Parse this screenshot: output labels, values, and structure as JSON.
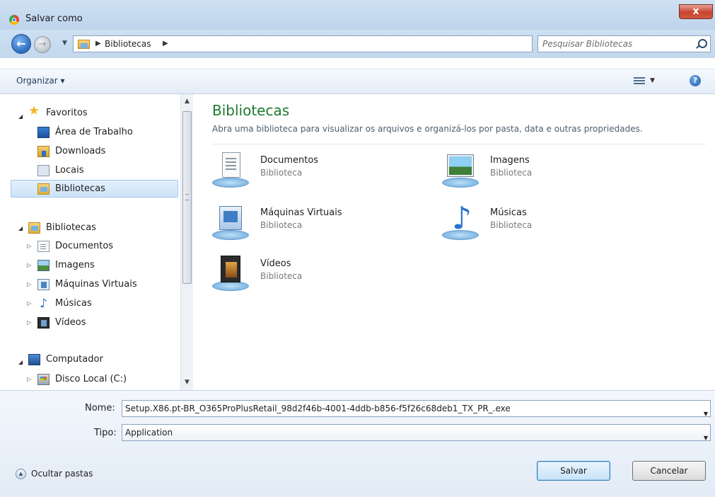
{
  "window": {
    "title": "Salvar como",
    "close_glyph": "x"
  },
  "address": {
    "crumb": "Bibliotecas",
    "search_placeholder": "Pesquisar Bibliotecas"
  },
  "toolbar": {
    "organize_label": "Organizar ▾"
  },
  "nav": {
    "favorites_header": "Favoritos",
    "favorites": [
      {
        "label": "Área de Trabalho",
        "icon": "desktop-icon"
      },
      {
        "label": "Downloads",
        "icon": "downloads-icon"
      },
      {
        "label": "Locais",
        "icon": "places-icon"
      },
      {
        "label": "Bibliotecas",
        "icon": "libraries-icon",
        "selected": true
      }
    ],
    "libraries_header": "Bibliotecas",
    "libraries": [
      {
        "label": "Documentos",
        "icon": "documents-icon"
      },
      {
        "label": "Imagens",
        "icon": "pictures-icon"
      },
      {
        "label": "Máquinas Virtuais",
        "icon": "virtual-machines-icon"
      },
      {
        "label": "Músicas",
        "icon": "music-icon"
      },
      {
        "label": "Vídeos",
        "icon": "videos-icon"
      }
    ],
    "computer_header": "Computador",
    "drives": [
      {
        "label": "Disco Local (C:)",
        "icon": "local-disk-icon"
      }
    ]
  },
  "content": {
    "title": "Bibliotecas",
    "description": "Abra uma biblioteca para visualizar os arquivos e organizá-los por pasta, data e outras propriedades.",
    "tiles": [
      {
        "name": "Documentos",
        "type": "Biblioteca",
        "icon": "documents-library-icon"
      },
      {
        "name": "Imagens",
        "type": "Biblioteca",
        "icon": "pictures-library-icon"
      },
      {
        "name": "Máquinas Virtuais",
        "type": "Biblioteca",
        "icon": "virtual-machines-library-icon"
      },
      {
        "name": "Músicas",
        "type": "Biblioteca",
        "icon": "music-library-icon"
      },
      {
        "name": "Vídeos",
        "type": "Biblioteca",
        "icon": "videos-library-icon"
      }
    ]
  },
  "form": {
    "name_label": "Nome:",
    "name_value": "Setup.X86.pt-BR_O365ProPlusRetail_98d2f46b-4001-4ddb-b856-f5f26c68deb1_TX_PR_.exe",
    "type_label": "Tipo:",
    "type_value": "Application"
  },
  "footer": {
    "hide_folders_label": "Ocultar pastas",
    "save_label": "Salvar",
    "cancel_label": "Cancelar"
  }
}
